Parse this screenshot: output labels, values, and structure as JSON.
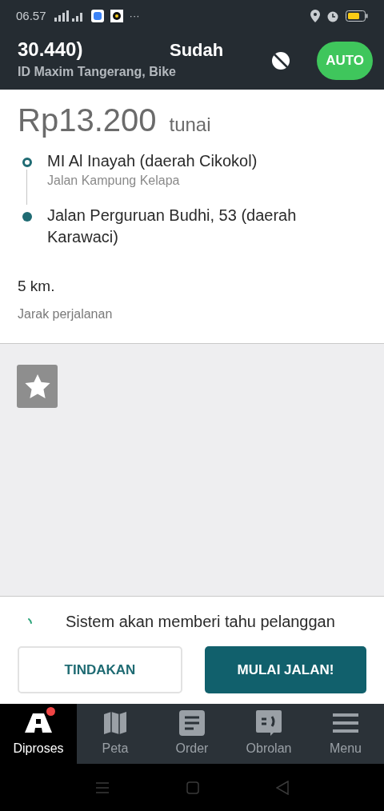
{
  "status_bar": {
    "time": "06.57",
    "overflow": "···"
  },
  "header": {
    "order_fragment": "30.440)",
    "status": "Sudah",
    "subtitle": "ID Maxim Tangerang, Bike",
    "auto_button": {
      "label": "AUTO",
      "on": true
    }
  },
  "order": {
    "price": "Rp13.200",
    "payment": "tunai",
    "route": [
      {
        "kind": "pickup",
        "title": "MI Al Inayah (daerah Cikokol)",
        "subtitle": "Jalan Kampung Kelapa"
      },
      {
        "kind": "dropoff",
        "title": "Jalan Perguruan Budhi, 53 (daerah Karawaci)"
      }
    ],
    "distance": "5 km.",
    "distance_label": "Jarak perjalanan"
  },
  "notice": "Sistem akan memberi tahu pelanggan",
  "buttons": [
    {
      "kind": "outline",
      "label": "TINDAKAN"
    },
    {
      "kind": "filled",
      "label": "MULAI JALAN!"
    }
  ],
  "tabs": [
    {
      "kind": "process",
      "label": "Diproses",
      "selected": true,
      "badge": true
    },
    {
      "kind": "map",
      "label": "Peta",
      "selected": false,
      "badge": false
    },
    {
      "kind": "order",
      "label": "Order",
      "selected": false,
      "badge": false
    },
    {
      "kind": "chat",
      "label": "Obrolan",
      "selected": false,
      "badge": false
    },
    {
      "kind": "menu",
      "label": "Menu",
      "selected": false,
      "badge": false
    }
  ]
}
